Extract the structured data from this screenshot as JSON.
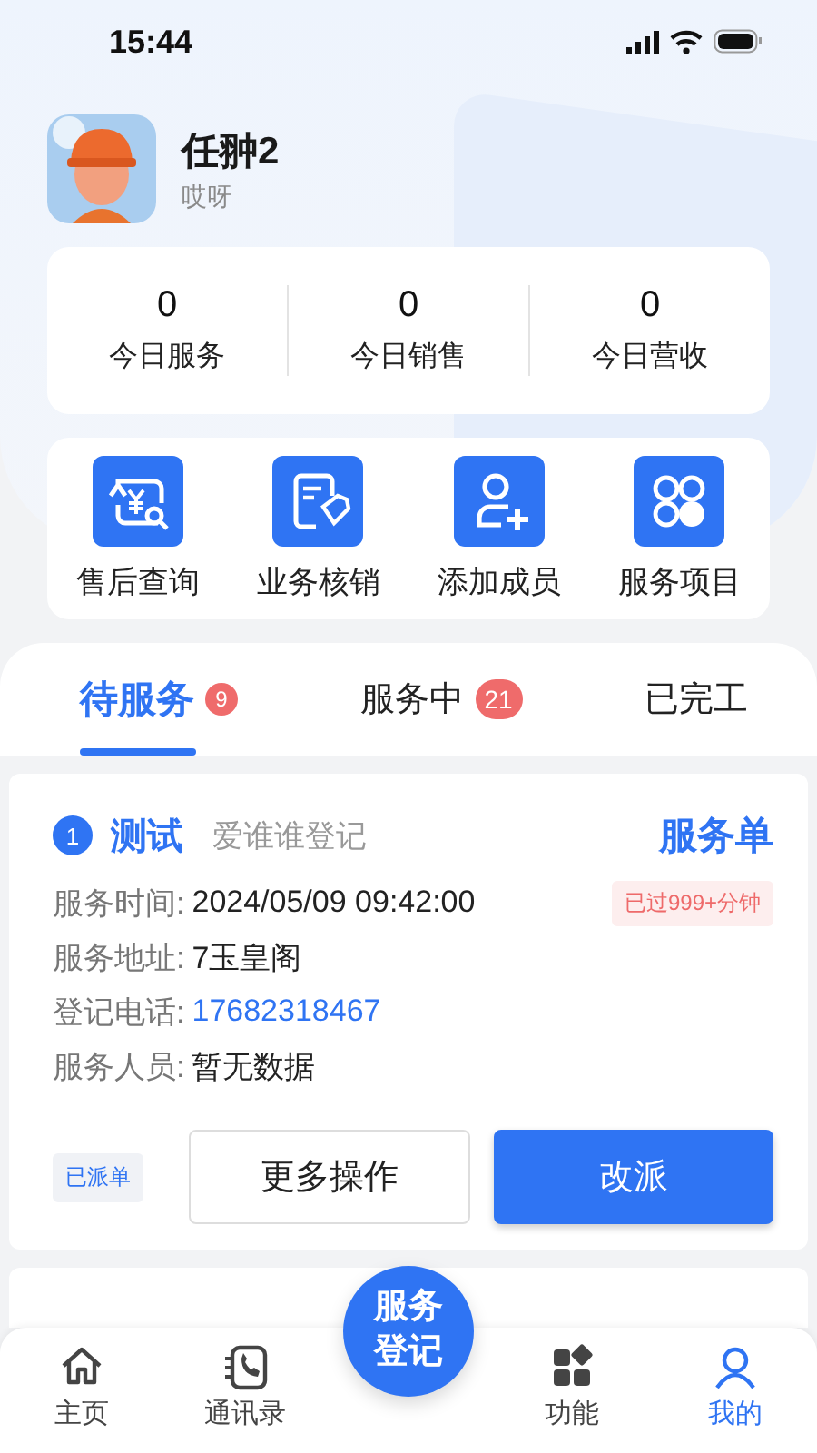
{
  "status_bar": {
    "time": "15:44"
  },
  "profile": {
    "name": "任翀2",
    "subtitle": "哎呀"
  },
  "stats": [
    {
      "value": "0",
      "label": "今日服务"
    },
    {
      "value": "0",
      "label": "今日销售"
    },
    {
      "value": "0",
      "label": "今日营收"
    }
  ],
  "actions": [
    {
      "label": "售后查询",
      "kind": "refund"
    },
    {
      "label": "业务核销",
      "kind": "voucher"
    },
    {
      "label": "添加成员",
      "kind": "member"
    },
    {
      "label": "服务项目",
      "kind": "apps"
    }
  ],
  "tabs": [
    {
      "label": "待服务",
      "badge": "9",
      "selected": true
    },
    {
      "label": "服务中",
      "badge": "21",
      "selected": false
    },
    {
      "label": "已完工",
      "selected": false
    }
  ],
  "orders": [
    {
      "index": "1",
      "title": "测试",
      "registrant": "爱谁谁登记",
      "type": "服务单",
      "overdue": "已过999+分钟",
      "fields": [
        {
          "label": "服务时间:",
          "value": "2024/05/09 09:42:00",
          "kind": "text"
        },
        {
          "label": "服务地址:",
          "value": "7玉皇阁",
          "kind": "text"
        },
        {
          "label": "登记电话:",
          "value": "17682318467",
          "kind": "phone"
        },
        {
          "label": "服务人员:",
          "value": "暂无数据",
          "kind": "text"
        }
      ],
      "status": "已派单",
      "buttons": [
        {
          "label": "更多操作",
          "kind": "secondary"
        },
        {
          "label": "改派",
          "kind": "primary"
        }
      ]
    }
  ],
  "nav": {
    "items": [
      {
        "label": "主页",
        "kind": "home",
        "selected": false
      },
      {
        "label": "通讯录",
        "kind": "contacts",
        "selected": false
      },
      {
        "label": "功能",
        "kind": "functions",
        "selected": false
      },
      {
        "label": "我的",
        "kind": "me",
        "selected": true
      }
    ],
    "center": "服务登记"
  }
}
